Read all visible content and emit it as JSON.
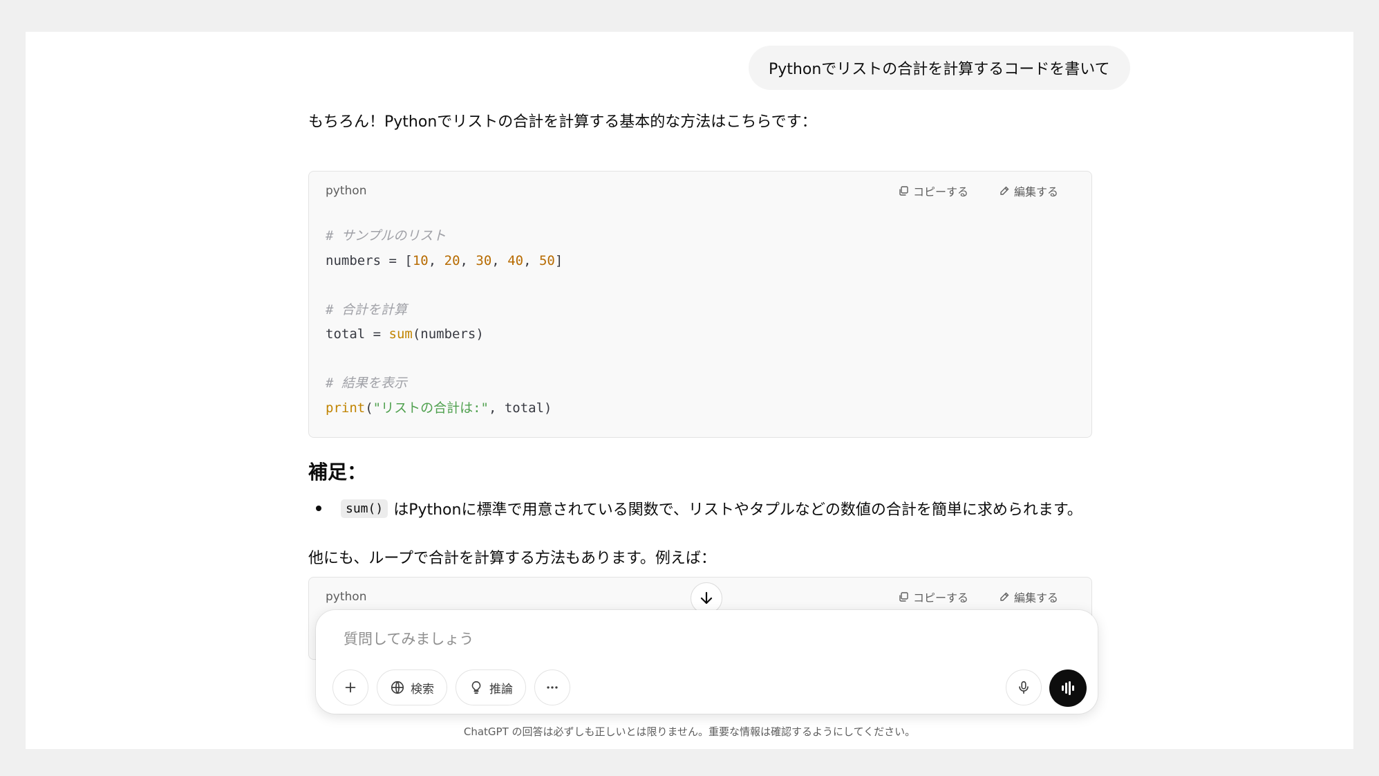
{
  "user_message": "Pythonでリストの合計を計算するコードを書いて",
  "assistant": {
    "intro": "もちろん！Pythonでリストの合計を計算する基本的な方法はこちらです：",
    "code_block_1": {
      "language": "python",
      "copy_label": "コピーする",
      "edit_label": "編集する",
      "lines": [
        "# サンプルのリスト",
        "numbers = [10, 20, 30, 40, 50]",
        "",
        "# 合計を計算",
        "total = sum(numbers)",
        "",
        "# 結果を表示",
        "print(\"リストの合計は:\", total)"
      ]
    },
    "supplement_heading": "補足：",
    "bullet": {
      "code": "sum()",
      "text": "はPythonに標準で用意されている関数で、リストやタプルなどの数値の合計を簡単に求められます。"
    },
    "other_methods": "他にも、ループで合計を計算する方法もあります。例えば：",
    "code_block_2": {
      "language": "python",
      "copy_label": "コピーする",
      "edit_label": "編集する"
    }
  },
  "composer": {
    "placeholder": "質問してみましょう",
    "search_label": "検索",
    "reason_label": "推論"
  },
  "footer_note": "ChatGPT の回答は必ずしも正しいとは限りません。重要な情報は確認するようにしてください。",
  "icons": {
    "copy": "copy-icon",
    "edit": "edit-icon",
    "scroll": "arrow-down-icon",
    "plus": "plus-icon",
    "globe": "globe-icon",
    "bulb": "lightbulb-icon",
    "more": "ellipsis-icon",
    "mic": "mic-icon",
    "voice": "voice-wave-icon"
  }
}
